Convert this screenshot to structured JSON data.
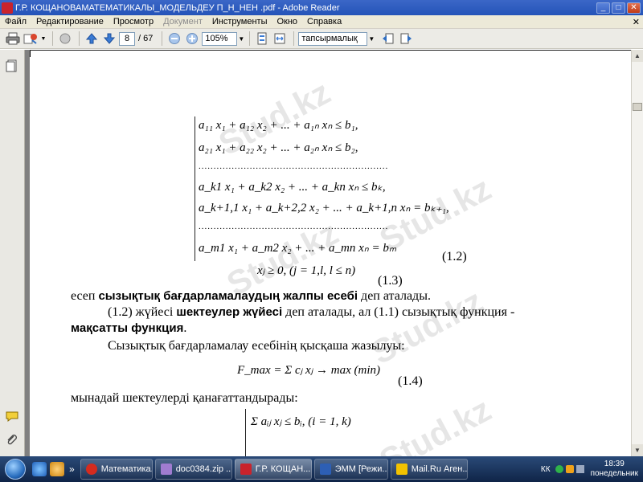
{
  "window": {
    "title": "Г.Р. КОЩАНОВАМАТЕМАТИКАЛЫ_МОДЕЛЬДЕУ П_Н_НЕН .pdf - Adobe Reader",
    "minimize": "_",
    "maximize": "□",
    "close": "✕"
  },
  "menu": {
    "items": [
      "Файл",
      "Редактирование",
      "Просмотр",
      "Документ",
      "Инструменты",
      "Окно",
      "Справка"
    ],
    "close": "✕"
  },
  "toolbar": {
    "page_current": "8",
    "page_total": "/ 67",
    "zoom": "105%",
    "search": "тапсырмалық"
  },
  "document": {
    "system_lines": [
      "a₁₁ x₁ + a₁₂ x₂ + ... + a₁ₙ xₙ ≤ b₁,",
      "a₂₁ x₁ + a₂₂ x₂ + ... + a₂ₙ xₙ ≤ b₂,",
      "a_k1 x₁ + a_k2 x₂ + ... + a_kn xₙ ≤ bₖ,",
      "a_k+1,1 x₁ + a_k+2,2 x₂ + ... + a_k+1,n xₙ = bₖ₊₁,",
      "a_m1 x₁ + a_m2 x₂ + ... + a_mn xₙ = bₘ"
    ],
    "dots": ".......................................................................................",
    "constraint": "xⱼ ≥ 0,   (j = 1,l, l ≤ n)",
    "eq_1_2": "(1.2)",
    "eq_1_3": "(1.3)",
    "p1_pre": "есеп ",
    "p1_bold": "сызықтық бағдарламалаудың жалпы есебі",
    "p1_post": " деп аталады.",
    "p2_pre": "(1.2) жүйесі ",
    "p2_bold": "шектеулер жүйесі",
    "p2_post": " деп аталады, ал (1.1) сызықтық функция -",
    "p2b_bold": "мақсатты функция",
    "p2b_post": ".",
    "p3": "Сызықтық бағдарламалау есебінің қысқаша жазылуы:",
    "objective": "F_max = Σ cⱼ xⱼ → max   (min)",
    "eq_1_4": "(1.4)",
    "p4": "мынадай шектеулерді қанағаттандырады:",
    "constraint2": "Σ aᵢⱼ xⱼ ≤ bᵢ,  (i = 1, k)",
    "watermark": "Stud.kz"
  },
  "taskbar": {
    "tasks": [
      {
        "label": "Математика..."
      },
      {
        "label": "doc0384.zip ..."
      },
      {
        "label": "Г.Р. КОЩАН..."
      },
      {
        "label": "ЭММ [Режи..."
      },
      {
        "label": "Mail.Ru Аген..."
      }
    ],
    "more": "»",
    "lang": "КК",
    "time": "18:39",
    "day": "понедельник"
  },
  "colors": {
    "titlebar": "#2454b8",
    "taskbar": "#0f2447",
    "doc_bg": "#808080"
  }
}
